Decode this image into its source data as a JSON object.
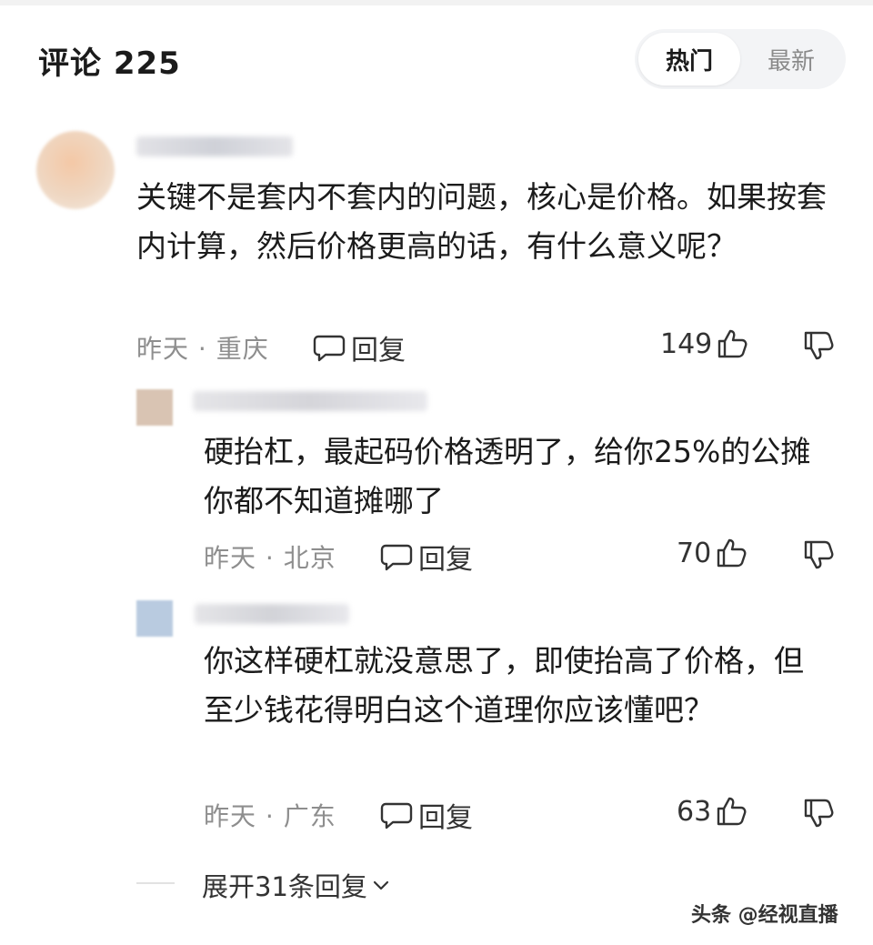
{
  "header": {
    "title": "评论 225",
    "tabs": [
      {
        "label": "热门",
        "active": true
      },
      {
        "label": "最新",
        "active": false
      }
    ]
  },
  "comment": {
    "text": "关键不是套内不套内的问题，核心是价格。如果按套内计算，然后价格更高的话，有什么意义呢？",
    "meta": "昨天 · 重庆",
    "reply_label": "回复",
    "likes": "149"
  },
  "replies": [
    {
      "text": "硬抬杠，最起码价格透明了，给你25%的公摊你都不知道摊哪了",
      "meta": "昨天 · 北京",
      "reply_label": "回复",
      "likes": "70"
    },
    {
      "text": "你这样硬杠就没意思了，即使抬高了价格，但至少钱花得明白这个道理你应该懂吧？",
      "meta": "昨天 · 广东",
      "reply_label": "回复",
      "likes": "63"
    }
  ],
  "expand_label": "展开31条回复",
  "watermark": "头条 @经视直播",
  "icons": [
    "reply-icon",
    "thumbs-up-icon",
    "thumbs-down-icon",
    "chevron-down-icon"
  ],
  "colors": {
    "meta_text": "#8e8e8e",
    "tab_bg": "#f3f4f6",
    "text": "#1b1b1b"
  }
}
